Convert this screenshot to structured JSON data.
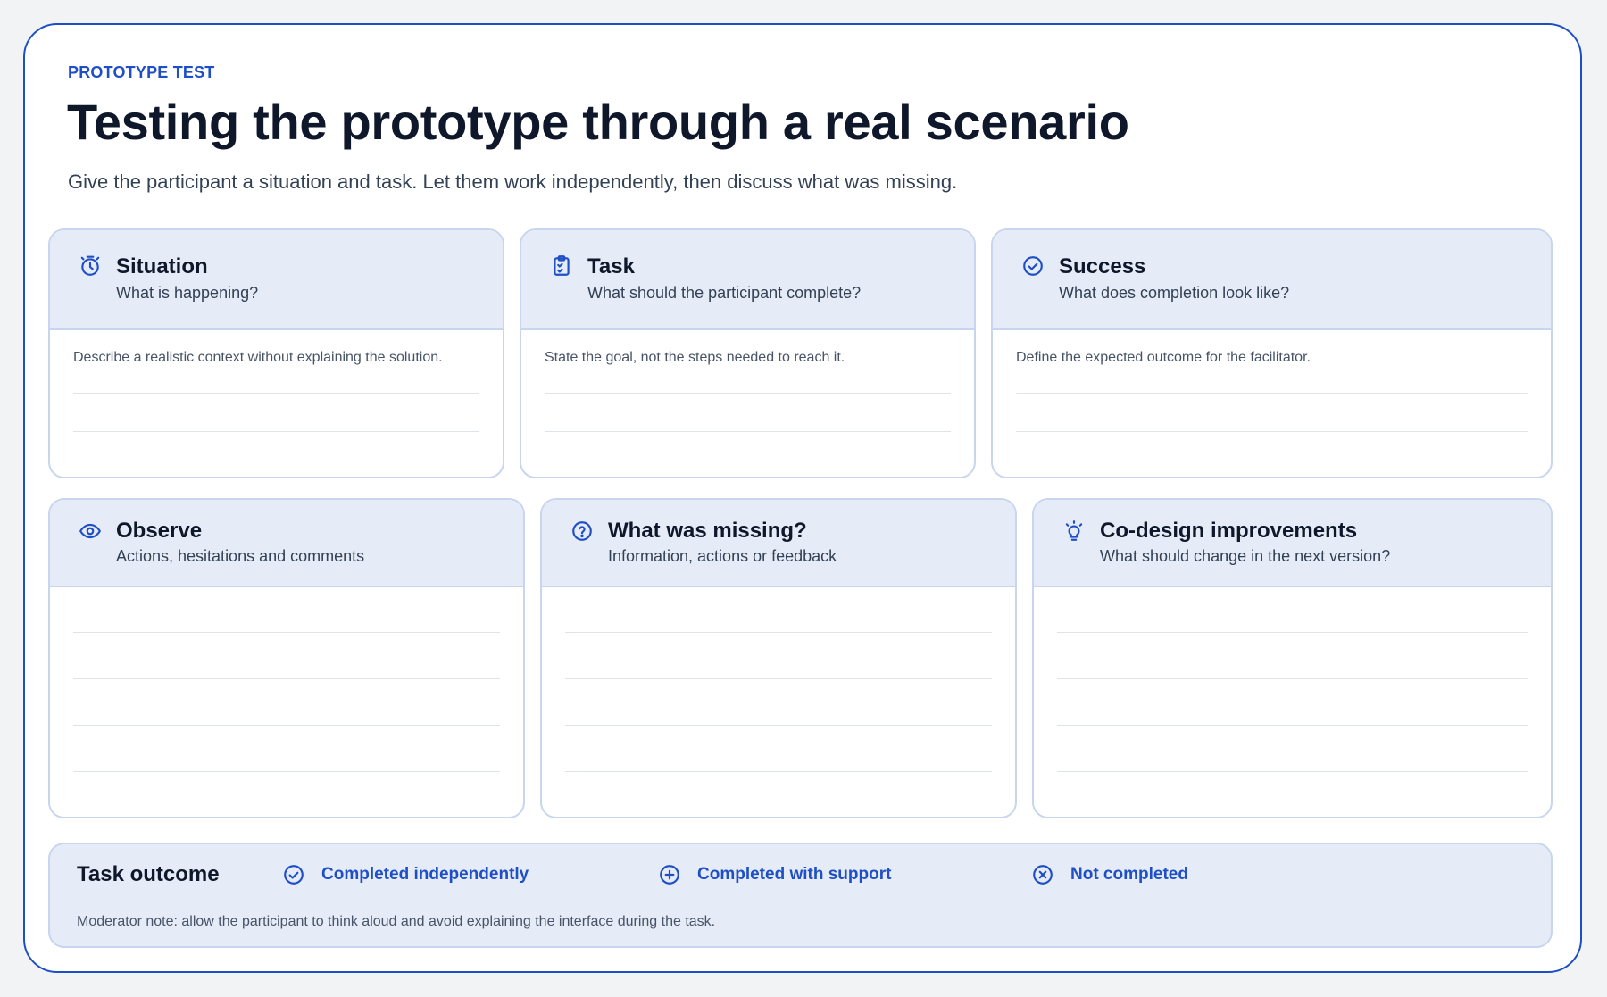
{
  "header": {
    "eyebrow": "PROTOTYPE TEST",
    "title": "Testing the prototype through a real scenario",
    "subtitle": "Give the participant a situation and task. Let them work independently, then discuss what was missing."
  },
  "top_cards": [
    {
      "title": "Situation",
      "subtitle": "What is happening?",
      "hint": "Describe a realistic context without explaining the solution.",
      "icon": "timer-icon"
    },
    {
      "title": "Task",
      "subtitle": "What should the participant complete?",
      "hint": "State the goal, not the steps needed to reach it.",
      "icon": "clipboard-check-icon"
    },
    {
      "title": "Success",
      "subtitle": "What does completion look like?",
      "hint": "Define the expected outcome for the facilitator.",
      "icon": "check-circle-icon"
    }
  ],
  "bottom_cards": [
    {
      "title": "Observe",
      "subtitle": "Actions, hesitations and comments",
      "icon": "eye-icon"
    },
    {
      "title": "What was missing?",
      "subtitle": "Information, actions or feedback",
      "icon": "question-circle-icon"
    },
    {
      "title": "Co-design improvements",
      "subtitle": "What should change in the next version?",
      "icon": "lightbulb-icon"
    }
  ],
  "outcome": {
    "title": "Task outcome",
    "options": [
      {
        "label": "Completed independently",
        "icon": "check-circle-icon"
      },
      {
        "label": "Completed with support",
        "icon": "plus-circle-icon"
      },
      {
        "label": "Not completed",
        "icon": "x-circle-icon"
      }
    ],
    "note": "Moderator note: allow the participant to think aloud and avoid explaining the interface during the task."
  },
  "colors": {
    "accent": "#1f4fc6",
    "panel": "#e6ecf7",
    "border": "#c8d5ee"
  }
}
